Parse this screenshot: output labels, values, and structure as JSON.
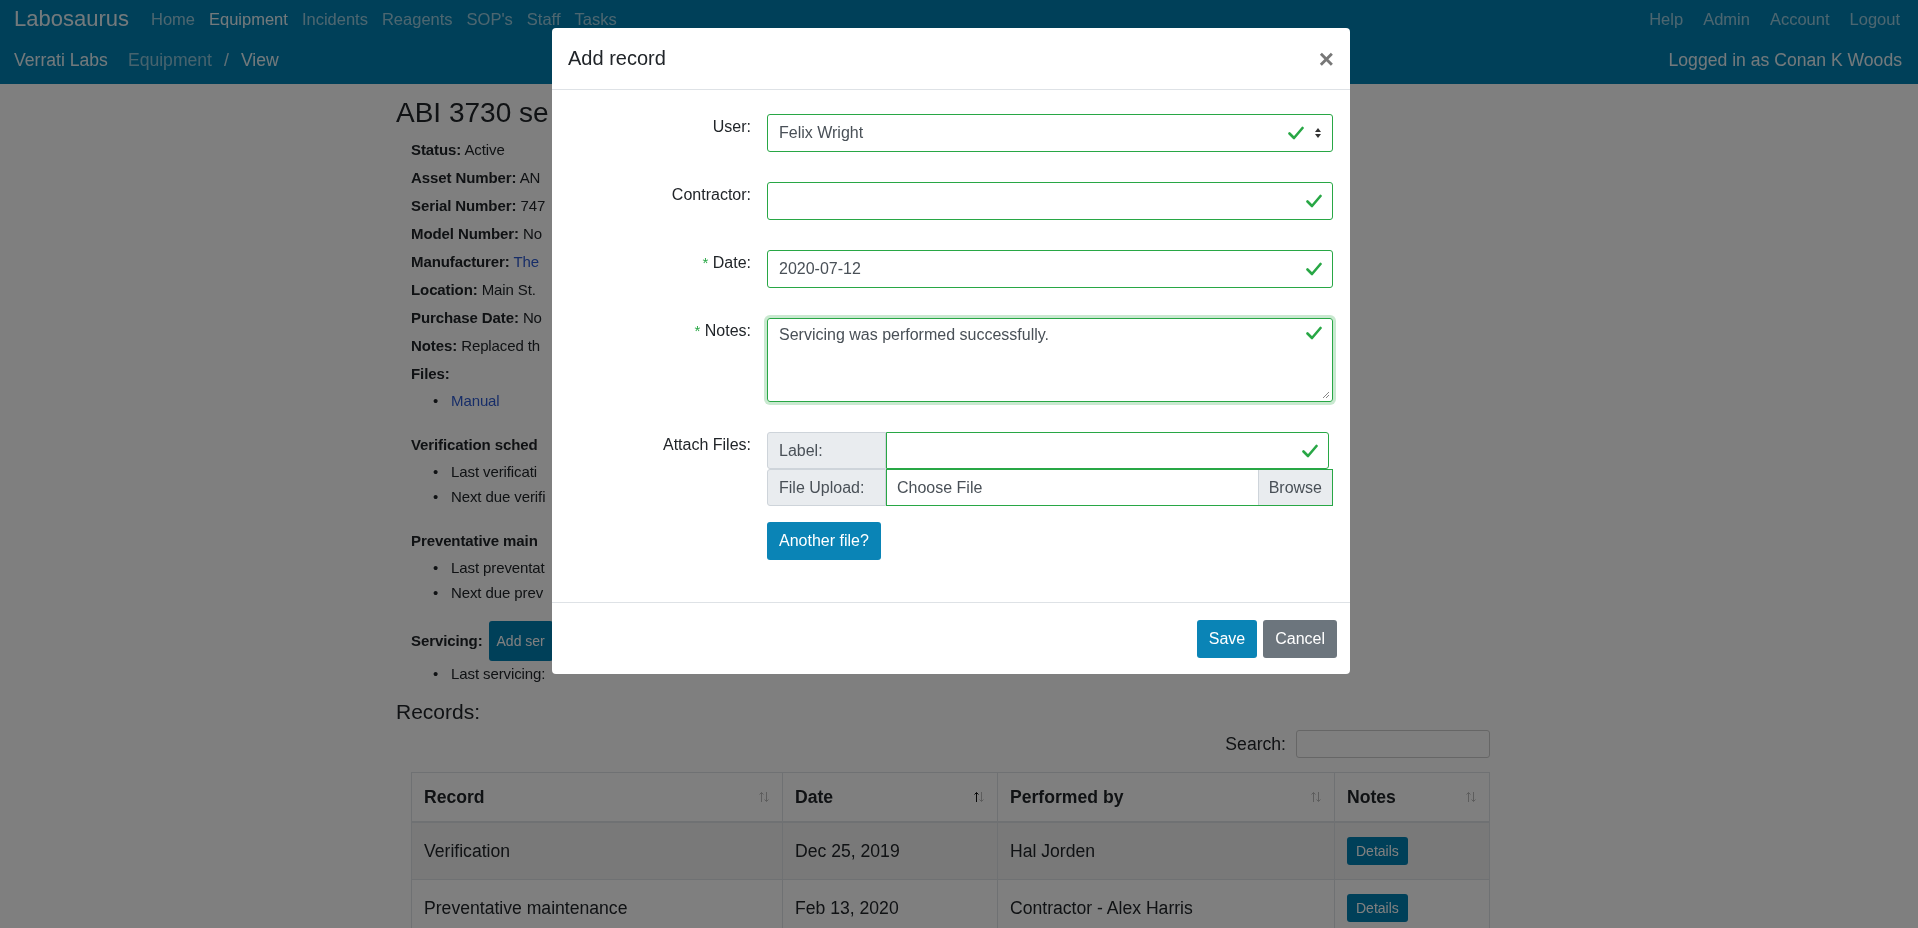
{
  "navbar": {
    "brand": "Labosaurus",
    "links": [
      {
        "label": "Home",
        "selected": false
      },
      {
        "label": "Equipment",
        "selected": true
      },
      {
        "label": "Incidents",
        "selected": false
      },
      {
        "label": "Reagents",
        "selected": false
      },
      {
        "label": "SOP's",
        "selected": false
      },
      {
        "label": "Staff",
        "selected": false
      },
      {
        "label": "Tasks",
        "selected": false
      }
    ],
    "right_links": [
      "Help",
      "Admin",
      "Account",
      "Logout"
    ],
    "breadcrumb": [
      {
        "label": "Verrati Labs",
        "kind": "lab"
      },
      {
        "label": "Equipment",
        "kind": "link"
      },
      {
        "label": "/",
        "kind": "separator"
      },
      {
        "label": "View",
        "kind": "active"
      }
    ],
    "user_text": "Logged in as Conan K Woods"
  },
  "page": {
    "title": "ABI 3730 se",
    "details": [
      {
        "label": "Status:",
        "value": "Active",
        "kind": "text"
      },
      {
        "label": "Asset Number:",
        "value": "AN",
        "kind": "text"
      },
      {
        "label": "Serial Number:",
        "value": "747",
        "kind": "text"
      },
      {
        "label": "Model Number:",
        "value": "No",
        "kind": "text"
      },
      {
        "label": "Manufacturer:",
        "value": "The",
        "kind": "link"
      },
      {
        "label": "Location:",
        "value": "Main St.",
        "kind": "text"
      },
      {
        "label": "Purchase Date:",
        "value": "No",
        "kind": "text"
      },
      {
        "label": "Notes:",
        "value": "Replaced th",
        "kind": "text"
      }
    ],
    "files": {
      "label": "Files:",
      "links": [
        {
          "bullet": "•",
          "text": "Manual"
        }
      ]
    },
    "sections": [
      {
        "title": "Verification sched",
        "items": [
          {
            "bullet": "•",
            "text": "Last verificati"
          },
          {
            "bullet": "•",
            "text": "Next due verifi"
          }
        ]
      },
      {
        "title": "Preventative main",
        "items": [
          {
            "bullet": "•",
            "text": "Last preventat"
          },
          {
            "bullet": "•",
            "text": "Next due prev"
          }
        ]
      }
    ],
    "servicing": {
      "label": "Servicing:",
      "button": "Add ser",
      "items": [
        {
          "bullet": "•",
          "text": "Last servicing:"
        }
      ]
    },
    "records_title": "Records:",
    "search_label": "Search:",
    "table": {
      "columns": [
        {
          "label": "Record",
          "sorted": false
        },
        {
          "label": "Date",
          "sorted": true
        },
        {
          "label": "Performed by",
          "sorted": false
        },
        {
          "label": "Notes",
          "sorted": false
        }
      ],
      "rows": [
        {
          "cells": [
            "Verification",
            "Dec 25, 2019",
            "Hal Jorden"
          ],
          "button": "Details"
        },
        {
          "cells": [
            "Preventative maintenance",
            "Feb 13, 2020",
            "Contractor - Alex Harris"
          ],
          "button": "Details"
        }
      ]
    }
  },
  "modal": {
    "title": "Add record",
    "close": "×",
    "fields": [
      {
        "kind": "select",
        "label": "User:",
        "value": "Felix Wright",
        "valid": true
      },
      {
        "kind": "text",
        "label": "Contractor:",
        "valid": true
      },
      {
        "kind": "text",
        "label": "Date:",
        "marker": "*",
        "value": "2020-07-12",
        "valid": true
      },
      {
        "kind": "textarea",
        "label": "Notes:",
        "marker": "*",
        "value": "Servicing was performed successfully.",
        "valid": true
      },
      {
        "kind": "attach",
        "label": "Attach Files:",
        "rows": [
          {
            "kind": "text",
            "addon": "Label:",
            "valid": true
          },
          {
            "kind": "file",
            "addon": "File Upload:",
            "value": "Choose File",
            "button": "Browse"
          }
        ],
        "another": "Another file?"
      }
    ],
    "buttons": [
      {
        "label": "Save",
        "kind": "primary"
      },
      {
        "label": "Cancel",
        "kind": "secondary"
      }
    ]
  }
}
